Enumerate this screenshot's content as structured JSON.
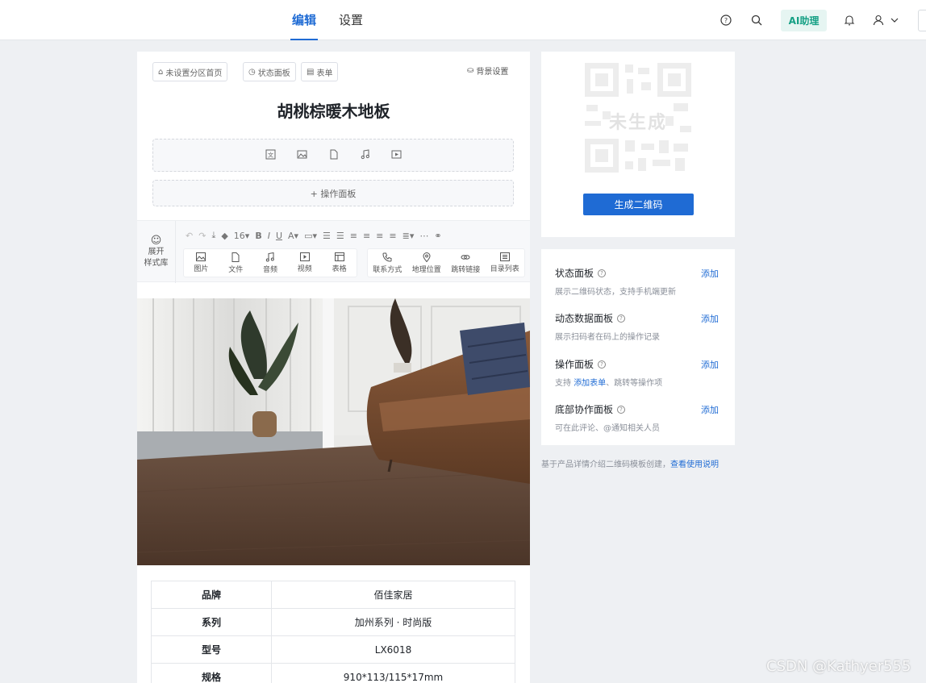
{
  "topbar": {
    "tabs": [
      {
        "label": "编辑"
      },
      {
        "label": "设置"
      }
    ],
    "ai_label": "AI助理"
  },
  "editor": {
    "chips": [
      "未设置分区首页",
      "状态面板",
      "表单"
    ],
    "bg_setting": "背景设置",
    "title": "胡桃棕暖木地板",
    "op_panel": "+ 操作面板",
    "toolbar": {
      "expand": "展开",
      "style_lib": "样式库",
      "font_size": "16",
      "insert_items": [
        "图片",
        "文件",
        "音频",
        "视频",
        "表格"
      ],
      "link_items": [
        "联系方式",
        "地理位置",
        "跳转链接",
        "目录列表"
      ]
    },
    "specs": [
      {
        "key": "品牌",
        "value": "佰佳家居"
      },
      {
        "key": "系列",
        "value": "加州系列 · 时尚版"
      },
      {
        "key": "型号",
        "value": "LX6018"
      },
      {
        "key": "规格",
        "value": "910*113/115*17mm"
      }
    ]
  },
  "qr": {
    "status": "未生成",
    "generate_label": "生成二维码"
  },
  "panels": [
    {
      "title": "状态面板",
      "desc": "展示二维码状态，支持手机端更新",
      "add": "添加"
    },
    {
      "title": "动态数据面板",
      "desc": "展示扫码者在码上的操作记录",
      "add": "添加"
    },
    {
      "title": "操作面板",
      "desc_prefix": "支持 ",
      "desc_link": "添加表单",
      "desc_suffix": "、跳转等操作项",
      "add": "添加"
    },
    {
      "title": "底部协作面板",
      "desc": "可在此评论、@通知相关人员",
      "add": "添加"
    }
  ],
  "footer": {
    "text": "基于产品详情介绍二维码模板创建，",
    "link": "查看使用说明"
  },
  "watermark": "CSDN @Kathyer555",
  "colors": {
    "accent": "#1f6bd4",
    "ai": "#16a085"
  }
}
